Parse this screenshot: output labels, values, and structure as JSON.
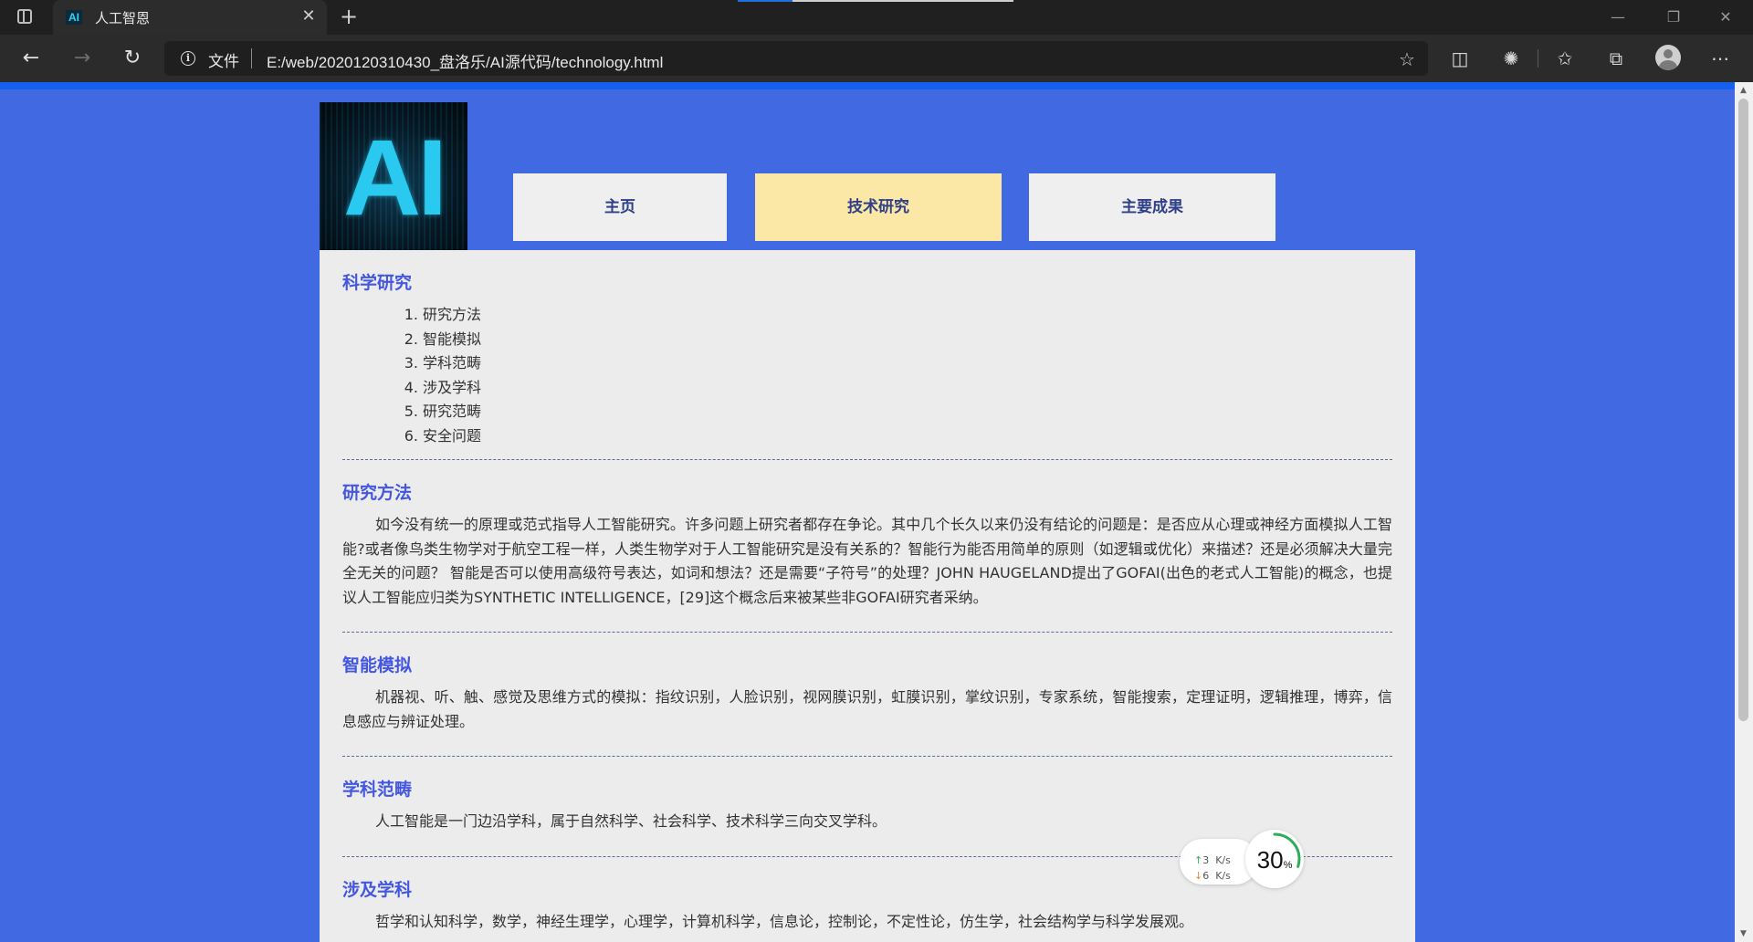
{
  "browser": {
    "tab_title": "人工智恩",
    "tab_favicon_text": "AI",
    "tab_close": "✕",
    "new_tab": "+",
    "address_label": "文件",
    "url": "E:/web/2020120310430_盘洛乐/AI源代码/technology.html",
    "icons": [
      "sidebar-toggle-icon",
      "back-icon",
      "forward-icon",
      "refresh-icon",
      "info-icon",
      "add-favorite-icon",
      "immersive-reader-icon",
      "extensions-icon",
      "favorites-icon",
      "collections-icon",
      "profile-icon",
      "more-icon",
      "minimize-icon",
      "restore-icon",
      "close-icon"
    ]
  },
  "site": {
    "logo_text": "AI",
    "nav": [
      {
        "label": "主页",
        "active": false
      },
      {
        "label": "技术研究",
        "active": true
      },
      {
        "label": "主要成果",
        "active": false
      }
    ],
    "colors": {
      "page_background": "#4169e1",
      "content_background": "#ececec",
      "heading": "#4457e0",
      "nav_active": "#fbe8a6",
      "nav_inactive": "#efefef"
    }
  },
  "content": {
    "toc_title": "科学研究",
    "toc": [
      {
        "num": "1.",
        "label": "研究方法"
      },
      {
        "num": "2.",
        "label": "智能模拟"
      },
      {
        "num": "3.",
        "label": "学科范畴"
      },
      {
        "num": "4.",
        "label": "涉及学科"
      },
      {
        "num": "5.",
        "label": "研究范畴"
      },
      {
        "num": "6.",
        "label": "安全问题"
      }
    ],
    "sections": [
      {
        "title": "研究方法",
        "text": "如今没有统一的原理或范式指导人工智能研究。许多问题上研究者都存在争论。其中几个长久以来仍没有结论的问题是：是否应从心理或神经方面模拟人工智能?或者像鸟类生物学对于航空工程一样，人类生物学对于人工智能研究是没有关系的？智能行为能否用简单的原则（如逻辑或优化）来描述？还是必须解决大量完全无关的问题？ 智能是否可以使用高级符号表达，如词和想法？还是需要“子符号”的处理？JOHN HAUGELAND提出了GOFAI(出色的老式人工智能)的概念，也提议人工智能应归类为SYNTHETIC INTELLIGENCE，[29]这个概念后来被某些非GOFAI研究者采纳。"
      },
      {
        "title": "智能模拟",
        "text": "机器视、听、触、感觉及思维方式的模拟：指纹识别，人脸识别，视网膜识别，虹膜识别，掌纹识别，专家系统，智能搜索，定理证明，逻辑推理，博弈，信息感应与辨证处理。"
      },
      {
        "title": "学科范畴",
        "text": "人工智能是一门边沿学科，属于自然科学、社会科学、技术科学三向交叉学科。"
      },
      {
        "title": "涉及学科",
        "text": "哲学和认知科学，数学，神经生理学，心理学，计算机科学，信息论，控制论，不定性论，仿生学，社会结构学与科学发展观。"
      }
    ]
  },
  "net_widget": {
    "upload": "3",
    "download": "6",
    "unit": "K/s",
    "percent": "30",
    "percent_sign": "%",
    "percent_value": 30
  }
}
